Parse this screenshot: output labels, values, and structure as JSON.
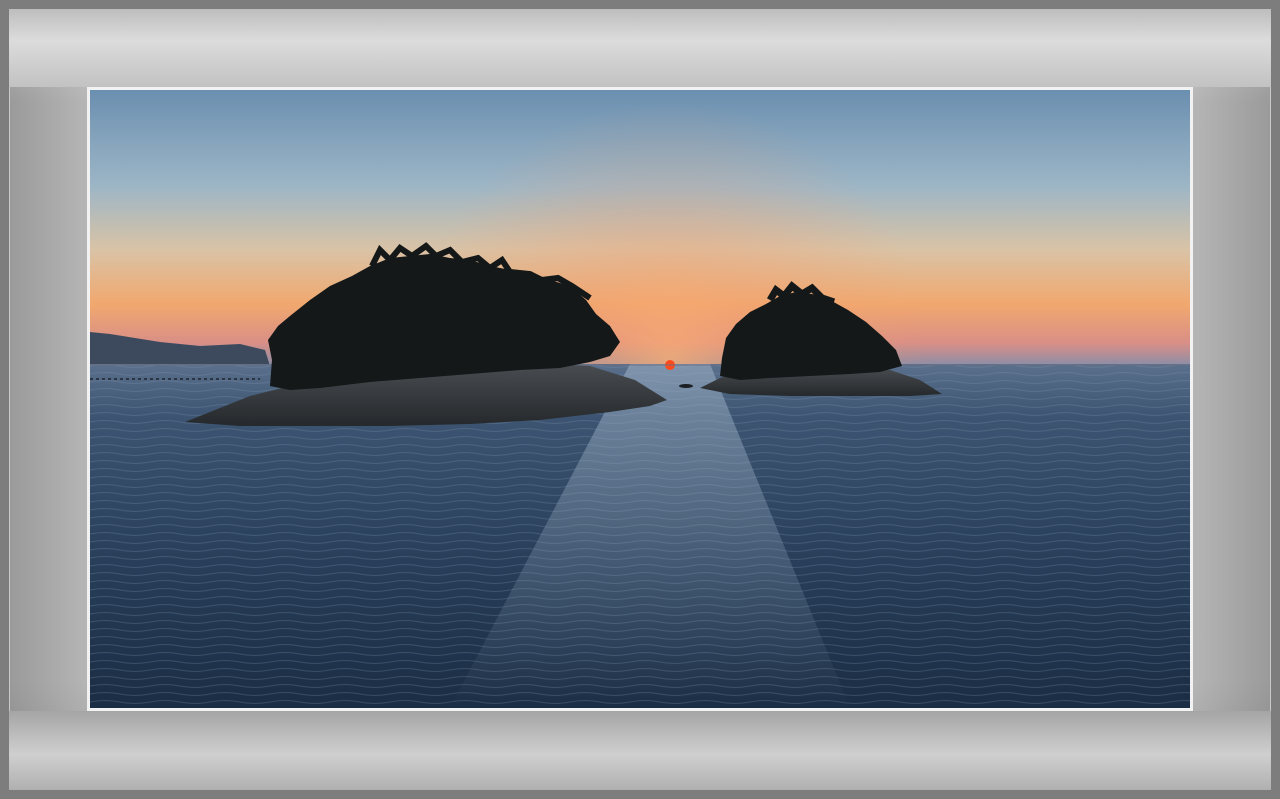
{
  "scene": {
    "subject": "",
    "colors": {
      "frame_outer": "#7d7d7d",
      "mat_light": "#d8d8d8",
      "mat_mid": "#b8b8b8",
      "photo_border": "#f2f2f2",
      "sky_top": "#6f93b3",
      "sky_horizon": "#f0a46a",
      "sun": "#ff4a1c",
      "water_dark": "#1f3248",
      "water_light": "#4b6a88",
      "island_dark": "#161a1c"
    }
  }
}
